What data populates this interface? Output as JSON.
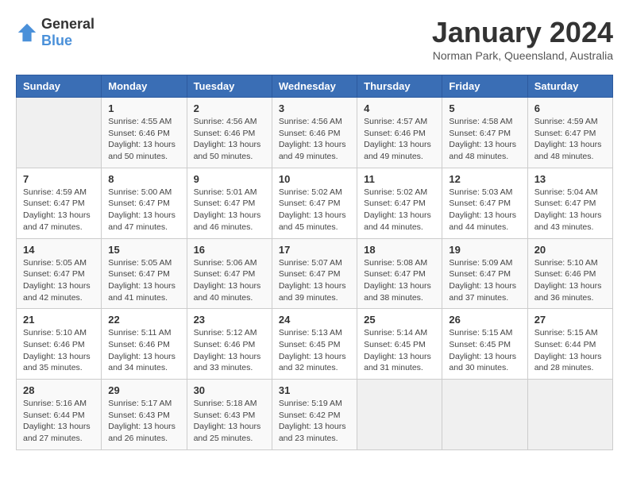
{
  "header": {
    "logo_general": "General",
    "logo_blue": "Blue",
    "month": "January 2024",
    "location": "Norman Park, Queensland, Australia"
  },
  "weekdays": [
    "Sunday",
    "Monday",
    "Tuesday",
    "Wednesday",
    "Thursday",
    "Friday",
    "Saturday"
  ],
  "weeks": [
    [
      {
        "num": "",
        "empty": true
      },
      {
        "num": "1",
        "sunrise": "Sunrise: 4:55 AM",
        "sunset": "Sunset: 6:46 PM",
        "daylight": "Daylight: 13 hours and 50 minutes."
      },
      {
        "num": "2",
        "sunrise": "Sunrise: 4:56 AM",
        "sunset": "Sunset: 6:46 PM",
        "daylight": "Daylight: 13 hours and 50 minutes."
      },
      {
        "num": "3",
        "sunrise": "Sunrise: 4:56 AM",
        "sunset": "Sunset: 6:46 PM",
        "daylight": "Daylight: 13 hours and 49 minutes."
      },
      {
        "num": "4",
        "sunrise": "Sunrise: 4:57 AM",
        "sunset": "Sunset: 6:46 PM",
        "daylight": "Daylight: 13 hours and 49 minutes."
      },
      {
        "num": "5",
        "sunrise": "Sunrise: 4:58 AM",
        "sunset": "Sunset: 6:47 PM",
        "daylight": "Daylight: 13 hours and 48 minutes."
      },
      {
        "num": "6",
        "sunrise": "Sunrise: 4:59 AM",
        "sunset": "Sunset: 6:47 PM",
        "daylight": "Daylight: 13 hours and 48 minutes."
      }
    ],
    [
      {
        "num": "7",
        "sunrise": "Sunrise: 4:59 AM",
        "sunset": "Sunset: 6:47 PM",
        "daylight": "Daylight: 13 hours and 47 minutes."
      },
      {
        "num": "8",
        "sunrise": "Sunrise: 5:00 AM",
        "sunset": "Sunset: 6:47 PM",
        "daylight": "Daylight: 13 hours and 47 minutes."
      },
      {
        "num": "9",
        "sunrise": "Sunrise: 5:01 AM",
        "sunset": "Sunset: 6:47 PM",
        "daylight": "Daylight: 13 hours and 46 minutes."
      },
      {
        "num": "10",
        "sunrise": "Sunrise: 5:02 AM",
        "sunset": "Sunset: 6:47 PM",
        "daylight": "Daylight: 13 hours and 45 minutes."
      },
      {
        "num": "11",
        "sunrise": "Sunrise: 5:02 AM",
        "sunset": "Sunset: 6:47 PM",
        "daylight": "Daylight: 13 hours and 44 minutes."
      },
      {
        "num": "12",
        "sunrise": "Sunrise: 5:03 AM",
        "sunset": "Sunset: 6:47 PM",
        "daylight": "Daylight: 13 hours and 44 minutes."
      },
      {
        "num": "13",
        "sunrise": "Sunrise: 5:04 AM",
        "sunset": "Sunset: 6:47 PM",
        "daylight": "Daylight: 13 hours and 43 minutes."
      }
    ],
    [
      {
        "num": "14",
        "sunrise": "Sunrise: 5:05 AM",
        "sunset": "Sunset: 6:47 PM",
        "daylight": "Daylight: 13 hours and 42 minutes."
      },
      {
        "num": "15",
        "sunrise": "Sunrise: 5:05 AM",
        "sunset": "Sunset: 6:47 PM",
        "daylight": "Daylight: 13 hours and 41 minutes."
      },
      {
        "num": "16",
        "sunrise": "Sunrise: 5:06 AM",
        "sunset": "Sunset: 6:47 PM",
        "daylight": "Daylight: 13 hours and 40 minutes."
      },
      {
        "num": "17",
        "sunrise": "Sunrise: 5:07 AM",
        "sunset": "Sunset: 6:47 PM",
        "daylight": "Daylight: 13 hours and 39 minutes."
      },
      {
        "num": "18",
        "sunrise": "Sunrise: 5:08 AM",
        "sunset": "Sunset: 6:47 PM",
        "daylight": "Daylight: 13 hours and 38 minutes."
      },
      {
        "num": "19",
        "sunrise": "Sunrise: 5:09 AM",
        "sunset": "Sunset: 6:47 PM",
        "daylight": "Daylight: 13 hours and 37 minutes."
      },
      {
        "num": "20",
        "sunrise": "Sunrise: 5:10 AM",
        "sunset": "Sunset: 6:46 PM",
        "daylight": "Daylight: 13 hours and 36 minutes."
      }
    ],
    [
      {
        "num": "21",
        "sunrise": "Sunrise: 5:10 AM",
        "sunset": "Sunset: 6:46 PM",
        "daylight": "Daylight: 13 hours and 35 minutes."
      },
      {
        "num": "22",
        "sunrise": "Sunrise: 5:11 AM",
        "sunset": "Sunset: 6:46 PM",
        "daylight": "Daylight: 13 hours and 34 minutes."
      },
      {
        "num": "23",
        "sunrise": "Sunrise: 5:12 AM",
        "sunset": "Sunset: 6:46 PM",
        "daylight": "Daylight: 13 hours and 33 minutes."
      },
      {
        "num": "24",
        "sunrise": "Sunrise: 5:13 AM",
        "sunset": "Sunset: 6:45 PM",
        "daylight": "Daylight: 13 hours and 32 minutes."
      },
      {
        "num": "25",
        "sunrise": "Sunrise: 5:14 AM",
        "sunset": "Sunset: 6:45 PM",
        "daylight": "Daylight: 13 hours and 31 minutes."
      },
      {
        "num": "26",
        "sunrise": "Sunrise: 5:15 AM",
        "sunset": "Sunset: 6:45 PM",
        "daylight": "Daylight: 13 hours and 30 minutes."
      },
      {
        "num": "27",
        "sunrise": "Sunrise: 5:15 AM",
        "sunset": "Sunset: 6:44 PM",
        "daylight": "Daylight: 13 hours and 28 minutes."
      }
    ],
    [
      {
        "num": "28",
        "sunrise": "Sunrise: 5:16 AM",
        "sunset": "Sunset: 6:44 PM",
        "daylight": "Daylight: 13 hours and 27 minutes."
      },
      {
        "num": "29",
        "sunrise": "Sunrise: 5:17 AM",
        "sunset": "Sunset: 6:43 PM",
        "daylight": "Daylight: 13 hours and 26 minutes."
      },
      {
        "num": "30",
        "sunrise": "Sunrise: 5:18 AM",
        "sunset": "Sunset: 6:43 PM",
        "daylight": "Daylight: 13 hours and 25 minutes."
      },
      {
        "num": "31",
        "sunrise": "Sunrise: 5:19 AM",
        "sunset": "Sunset: 6:42 PM",
        "daylight": "Daylight: 13 hours and 23 minutes."
      },
      {
        "num": "",
        "empty": true
      },
      {
        "num": "",
        "empty": true
      },
      {
        "num": "",
        "empty": true
      }
    ]
  ]
}
